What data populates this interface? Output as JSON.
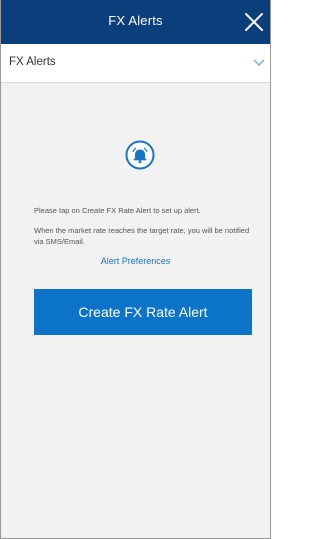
{
  "header": {
    "title": "FX Alerts"
  },
  "dropdown": {
    "selected": "FX Alerts"
  },
  "empty_state": {
    "line1": "Please tap on Create FX Rate Alert to set up alert.",
    "line2": "When the market rate reaches the target rate, you will be notified via SMS/Email.",
    "preferences_link": "Alert Preferences"
  },
  "actions": {
    "create_label": "Create FX Rate Alert"
  },
  "icons": {
    "close": "close-icon",
    "chevron": "chevron-down-icon",
    "bell": "bell-alert-icon"
  },
  "colors": {
    "header_bg": "#0a3f7c",
    "accent": "#0c74c8",
    "link": "#1a73c7",
    "background": "#f2f2f2"
  }
}
